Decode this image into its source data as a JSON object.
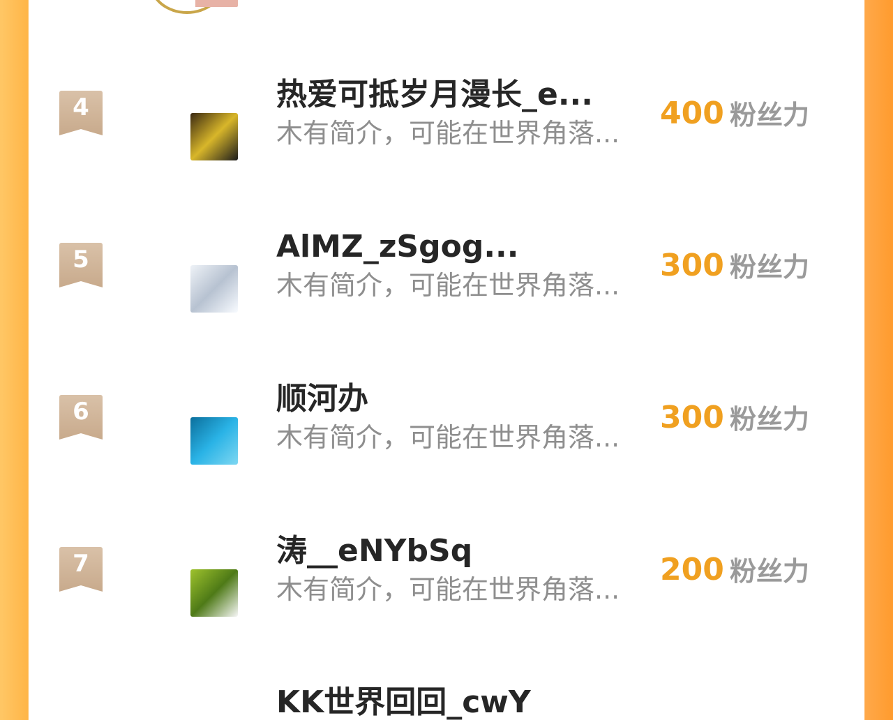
{
  "leaderboard": {
    "score_unit": "粉丝力",
    "rows": [
      {
        "rank": "4",
        "name": "热爱可抵岁月漫长_e...",
        "description": "木有简介，可能在世界角落...",
        "score": "400",
        "avatar_colors": [
          "#3b2a12",
          "#d8b62a",
          "#1c1c1c"
        ]
      },
      {
        "rank": "5",
        "name": "AlMZ_zSgog...",
        "description": "木有简介，可能在世界角落...",
        "score": "300",
        "avatar_colors": [
          "#eef2f7",
          "#b7c2d1",
          "#f8fbff"
        ]
      },
      {
        "rank": "6",
        "name": "顺河办",
        "description": "木有简介，可能在世界角落...",
        "score": "300",
        "avatar_colors": [
          "#0b6f9c",
          "#2ab3e6",
          "#7ed7f2"
        ]
      },
      {
        "rank": "7",
        "name": "涛__eNYbSq",
        "description": "木有简介，可能在世界角落...",
        "score": "200",
        "avatar_colors": [
          "#9ec22d",
          "#4e7a17",
          "#f7f7f7"
        ]
      }
    ],
    "partial_next_name": "KK世界回回_cwY"
  },
  "colors": {
    "accent": "#f0a020",
    "badge": "#cfb195",
    "name_text": "#262626",
    "description_text": "#8e8e8e",
    "border_left": "#ffb547",
    "border_right": "#ff9b2e"
  }
}
